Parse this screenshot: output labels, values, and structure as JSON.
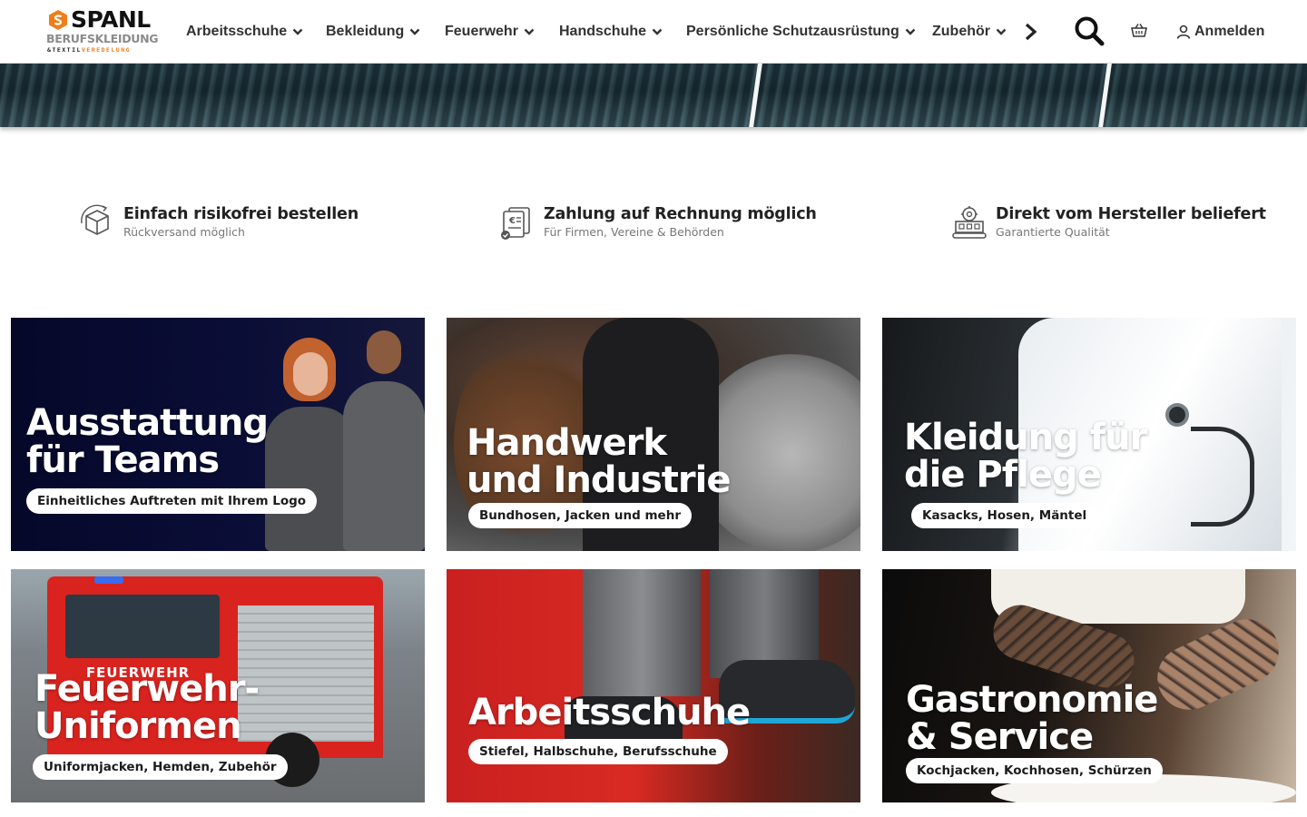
{
  "brand": {
    "name": "SPANL",
    "subtitle": "BERUFSKLEIDUNG",
    "tagline_a": "&TEXTIL",
    "tagline_b": "VEREDELUNG",
    "accent": "#ef7d19"
  },
  "nav": {
    "items": [
      {
        "label": "Arbeitsschuhe"
      },
      {
        "label": "Bekleidung"
      },
      {
        "label": "Feuerwehr"
      },
      {
        "label": "Handschuhe"
      },
      {
        "label": "Persönliche Schutzausrüstung"
      },
      {
        "label": "Zubehör"
      }
    ],
    "next_icon": "chevron-right-icon",
    "search_icon": "search-icon",
    "cart_icon": "basket-icon",
    "login_label": "Anmelden",
    "login_icon": "user-icon"
  },
  "features": [
    {
      "icon": "package-return-icon",
      "title": "Einfach risikofrei bestellen",
      "subtitle": "Rückversand möglich"
    },
    {
      "icon": "invoice-icon",
      "title": "Zahlung auf Rechnung möglich",
      "subtitle": "Für Firmen, Vereine & Behörden"
    },
    {
      "icon": "factory-icon",
      "title": "Direkt vom Hersteller beliefert",
      "subtitle": "Garantierte Qualität"
    }
  ],
  "categories": [
    {
      "title": "Ausstattung\nfür Teams",
      "pill": "Einheitliches Auftreten mit Ihrem Logo"
    },
    {
      "title": "Handwerk\nund Industrie",
      "pill": "Bundhosen, Jacken und mehr"
    },
    {
      "title": "Kleidung für\ndie Pflege",
      "pill": "Kasacks, Hosen, Mäntel"
    },
    {
      "title": "Feuerwehr-\nUniformen",
      "pill": "Uniformjacken, Hemden, Zubehör",
      "truck_text": "FEUERWEHR"
    },
    {
      "title": "Arbeitsschuhe",
      "pill": "Stiefel, Halbschuhe, Berufsschuhe"
    },
    {
      "title": "Gastronomie\n& Service",
      "pill": "Kochjacken, Kochhosen, Schürzen"
    }
  ]
}
